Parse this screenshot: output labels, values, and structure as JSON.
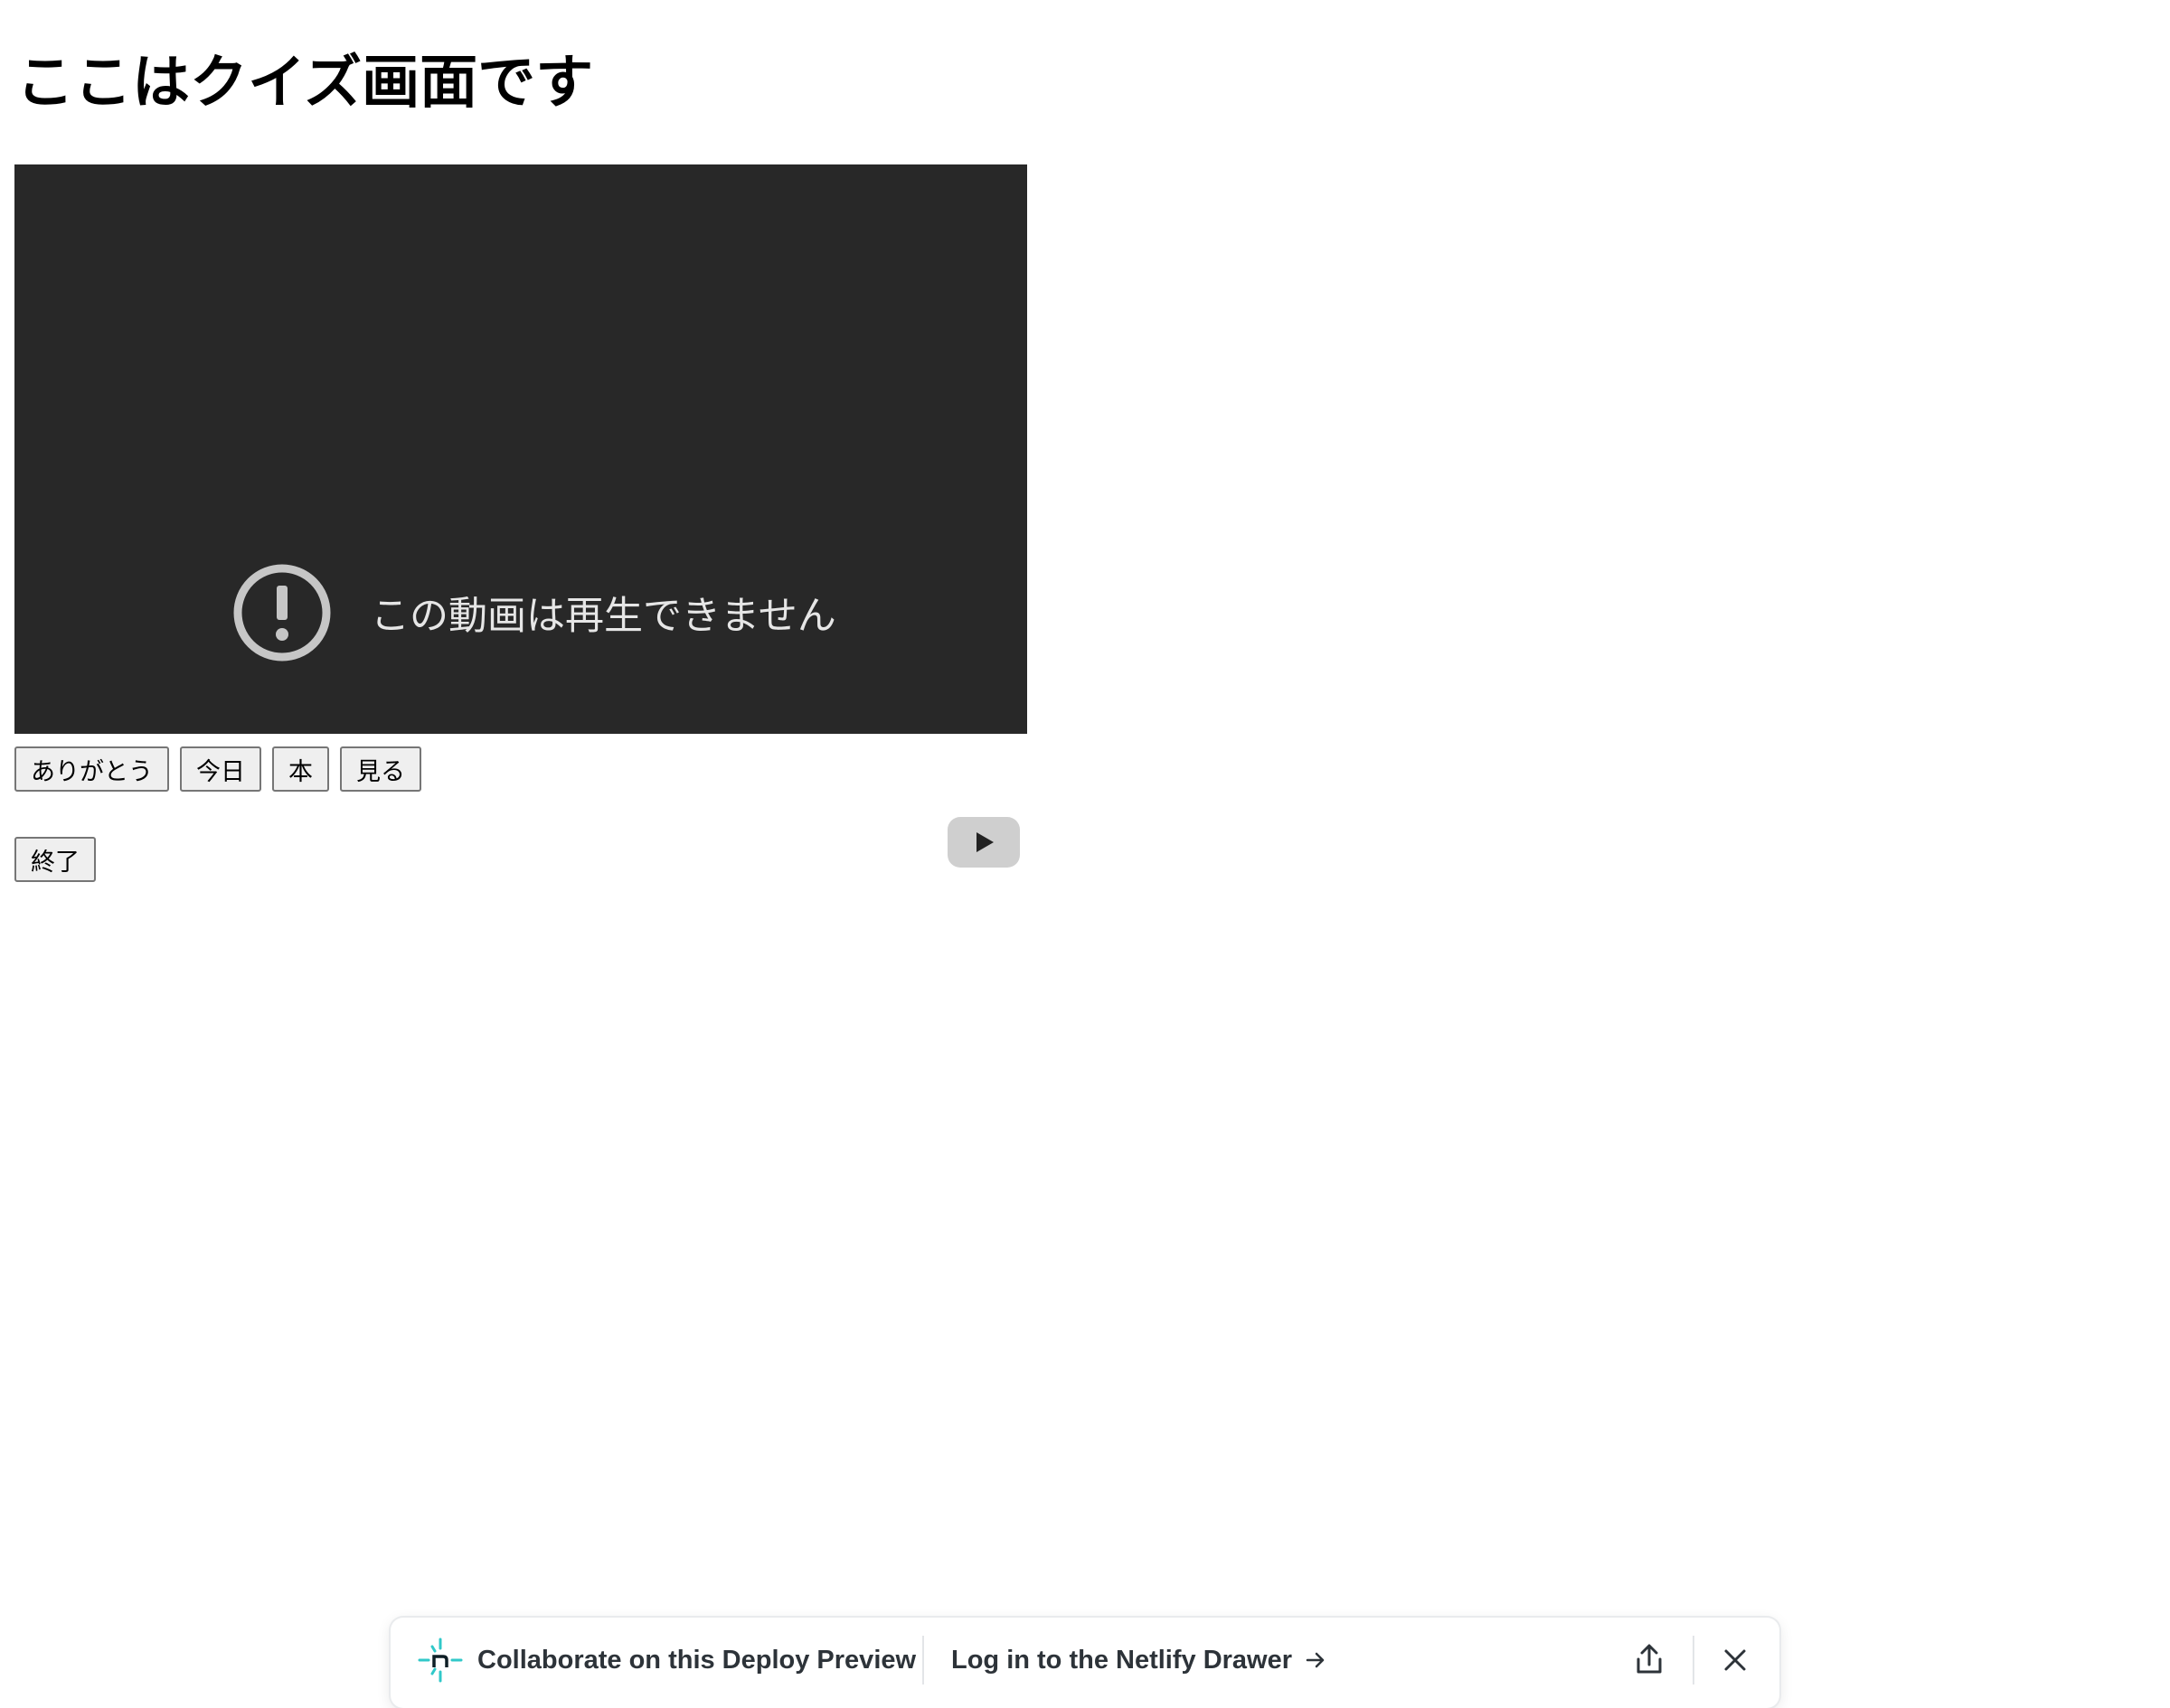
{
  "page": {
    "title": "ここはクイズ画面です"
  },
  "video": {
    "error_message": "この動画は再生できません"
  },
  "word_buttons": [
    {
      "label": "ありがとう"
    },
    {
      "label": "今日"
    },
    {
      "label": "本"
    },
    {
      "label": "見る"
    }
  ],
  "end_button": {
    "label": "終了"
  },
  "netlify_drawer": {
    "collaborate_label": "Collaborate on this Deploy Preview",
    "login_label": "Log in to the Netlify Drawer",
    "brand_color": "#30c8c9",
    "icons": [
      "netlify-logo-icon",
      "arrow-right-icon",
      "share-icon",
      "close-icon"
    ]
  }
}
